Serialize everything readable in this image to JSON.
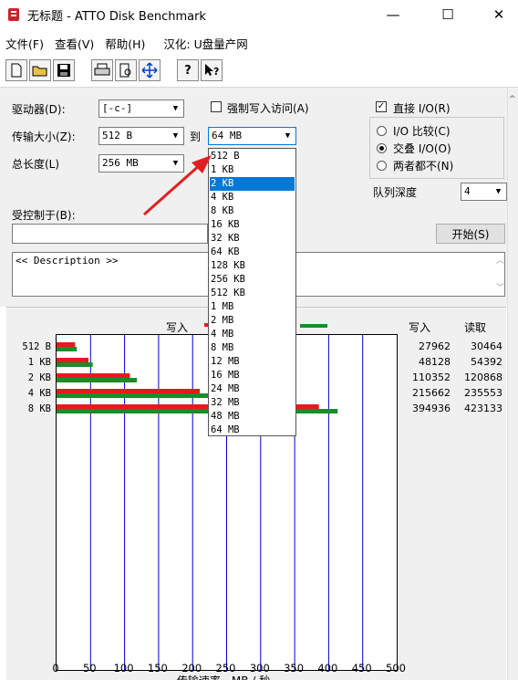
{
  "window": {
    "title": "无标题 - ATTO Disk Benchmark",
    "minimize": "—",
    "maximize": "☐",
    "close": "✕"
  },
  "menu": [
    "文件(F)",
    "查看(V)",
    "帮助(H)",
    "汉化: U盘量产网"
  ],
  "toolbar": {
    "icons": [
      "new-file-icon",
      "open-folder-icon",
      "save-icon",
      "print-icon",
      "print-preview-icon",
      "move-icon",
      "help-icon",
      "context-help-icon"
    ]
  },
  "controls": {
    "drive_label": "驱动器(D):",
    "drive_value": "[-c-]",
    "force_write_label": "强制写入访问(A)",
    "direct_io_label": "直接 I/O(R)",
    "transfer_size_label": "传输大小(Z):",
    "transfer_from": "512 B",
    "to_label": "到",
    "transfer_to": "64 MB",
    "total_length_label": "总长度(L)",
    "total_length_value": "256 MB",
    "io_compare_label": "I/O 比较(C)",
    "overlapped_io_label": "交叠 I/O(O)",
    "neither_label": "两者都不(N)",
    "queue_depth_label": "队列深度",
    "queue_depth_value": "4",
    "controlled_by_label": "受控制于(B):",
    "start_button": "开始(S)",
    "description": "<< Description >>"
  },
  "dropdown": {
    "items": [
      "512 B",
      "1 KB",
      "2 KB",
      "4 KB",
      "8 KB",
      "16 KB",
      "32 KB",
      "64 KB",
      "128 KB",
      "256 KB",
      "512 KB",
      "1 MB",
      "2 MB",
      "4 MB",
      "8 MB",
      "12 MB",
      "16 MB",
      "24 MB",
      "32 MB",
      "48 MB",
      "64 MB"
    ],
    "selected_index": 2
  },
  "chart_data": {
    "type": "bar",
    "categories": [
      "512 B",
      "1 KB",
      "2 KB",
      "4 KB",
      "8 KB"
    ],
    "series": [
      {
        "name": "写入",
        "color": "#e8191e",
        "values": [
          27962,
          48128,
          110352,
          215662,
          394936
        ]
      },
      {
        "name": "读取",
        "color": "#1b8c2a",
        "values": [
          30464,
          54392,
          120868,
          235553,
          423133
        ]
      }
    ],
    "xlim": [
      0,
      500
    ],
    "xticks": [
      0,
      50,
      100,
      150,
      200,
      250,
      300,
      350,
      400,
      450,
      500
    ],
    "xlabel": "传输速率 - MB / 秒",
    "legend_write": "写入",
    "legend_read": "读取",
    "col_write": "写入",
    "col_read": "读取"
  }
}
